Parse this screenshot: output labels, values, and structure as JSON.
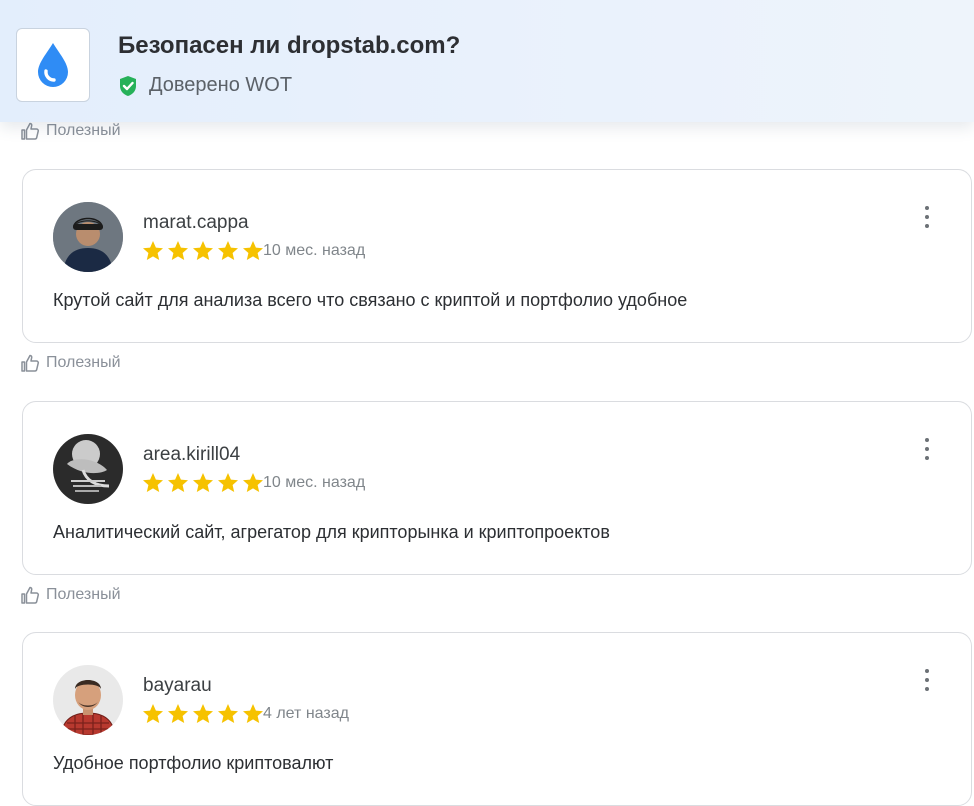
{
  "header": {
    "title": "Безопасен ли dropstab.com?",
    "trust_label": "Доверено WOT",
    "logo_icon": "water-drop-icon",
    "trust_icon": "shield-check-icon",
    "colors": {
      "drop": "#2f8cf5",
      "shield": "#26b159",
      "star": "#f6c200"
    }
  },
  "helpful_label": "Полезный",
  "reviews": [
    {
      "username": "marat.cappa",
      "rating": 5,
      "time": "10 мес. назад",
      "text": "Крутой сайт для анализа всего что связано с криптой и портфолио удобное"
    },
    {
      "username": "area.kirill04",
      "rating": 5,
      "time": "10 мес. назад",
      "text": "Аналитический сайт, агрегатор для крипторынка и криптопроектов"
    },
    {
      "username": "bayarau",
      "rating": 5,
      "time": "4 лет назад",
      "text": "Удобное портфолио криптовалют"
    }
  ]
}
